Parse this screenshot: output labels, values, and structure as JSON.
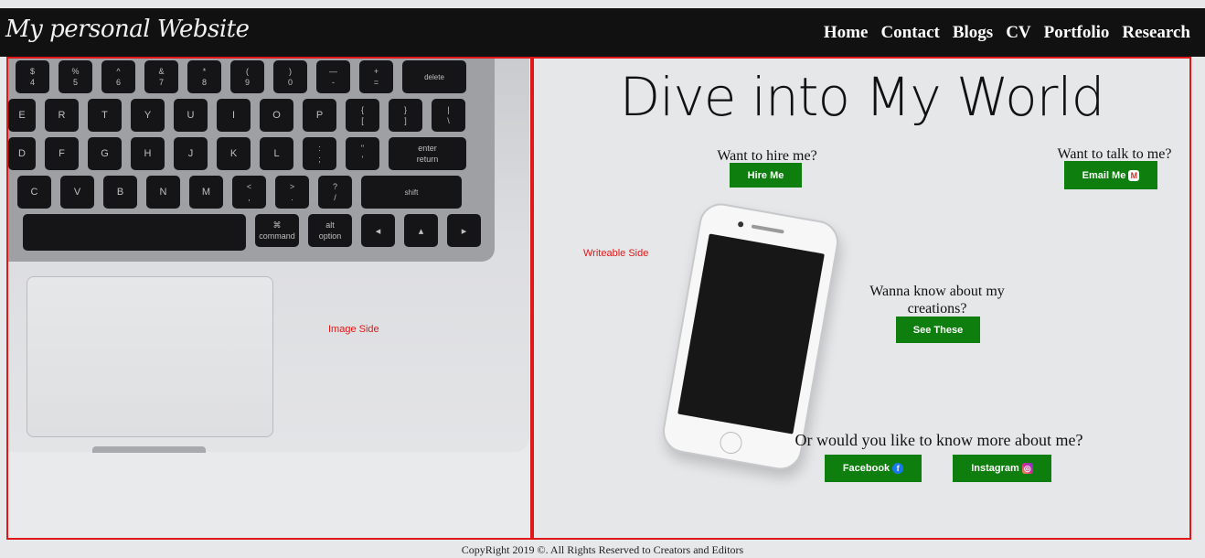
{
  "header": {
    "brand": "My personal Website",
    "nav": [
      "Home",
      "Contact",
      "Blogs",
      "CV",
      "Portfolio",
      "Research"
    ]
  },
  "image_side": {
    "label": "Image Side",
    "keyboard_rows": [
      [
        [
          "$",
          "4"
        ],
        [
          "%",
          "5"
        ],
        [
          "^",
          "6"
        ],
        [
          "&",
          "7"
        ],
        [
          "*",
          "8"
        ],
        [
          "(",
          "9"
        ],
        [
          ")",
          "0"
        ],
        [
          "—",
          "-"
        ],
        [
          "+",
          "="
        ],
        [
          "",
          "delete"
        ]
      ],
      [
        [
          "",
          "E"
        ],
        [
          "",
          "R"
        ],
        [
          "",
          "T"
        ],
        [
          "",
          "Y"
        ],
        [
          "",
          "U"
        ],
        [
          "",
          "I"
        ],
        [
          "",
          "O"
        ],
        [
          "",
          "P"
        ],
        [
          "{",
          "["
        ],
        [
          "}",
          "]"
        ],
        [
          "|",
          "\\"
        ]
      ],
      [
        [
          "",
          "D"
        ],
        [
          "",
          "F"
        ],
        [
          "",
          "G"
        ],
        [
          "",
          "H"
        ],
        [
          "",
          "J"
        ],
        [
          "",
          "K"
        ],
        [
          "",
          "L"
        ],
        [
          ":",
          ";"
        ],
        [
          "\"",
          "'"
        ],
        [
          "enter",
          "return"
        ]
      ],
      [
        [
          "",
          "C"
        ],
        [
          "",
          "V"
        ],
        [
          "",
          "B"
        ],
        [
          "",
          "N"
        ],
        [
          "",
          "M"
        ],
        [
          "<",
          ","
        ],
        [
          ">",
          "."
        ],
        [
          "?",
          "/"
        ],
        [
          "",
          "shift"
        ]
      ],
      [
        [
          "⌘",
          "command"
        ],
        [
          "alt",
          "option"
        ],
        [
          "",
          "◂"
        ],
        [
          "",
          "▴"
        ],
        [
          "",
          "▸"
        ]
      ]
    ]
  },
  "writeable_side": {
    "label": "Writeable Side",
    "title": "Dive into My World",
    "hire": {
      "prompt": "Want to hire me?",
      "button": "Hire Me"
    },
    "email": {
      "prompt": "Want to talk to me?",
      "button": "Email Me",
      "icon": "gmail-icon"
    },
    "creations": {
      "prompt": "Wanna know about my creations?",
      "button": "See These"
    },
    "social": {
      "prompt": "Or would you like to know more about me?",
      "facebook": "Facebook",
      "instagram": "Instagram"
    }
  },
  "footer": {
    "text": "CopyRight 2019 ©. All Rights Reserved to Creators and Editors"
  },
  "colors": {
    "navbar": "#111111",
    "button": "#0e7f0e",
    "border": "#e01818",
    "label": "#e01818"
  }
}
